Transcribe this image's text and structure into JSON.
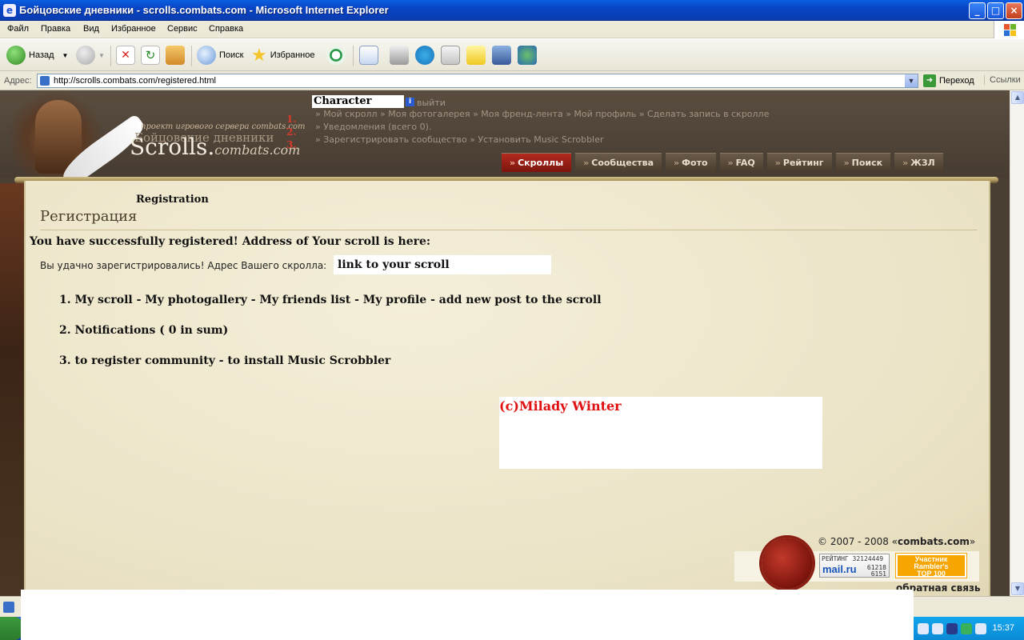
{
  "window": {
    "title": "Бойцовские дневники - scrolls.combats.com - Microsoft Internet Explorer",
    "min": "_",
    "max": "□",
    "close": "×"
  },
  "menu": [
    "Файл",
    "Правка",
    "Вид",
    "Избранное",
    "Сервис",
    "Справка"
  ],
  "toolbar": {
    "back": "Назад",
    "search": "Поиск",
    "favorites": "Избранное"
  },
  "address": {
    "label": "Адрес:",
    "url": "http://scrolls.combats.com/registered.html",
    "go": "Переход",
    "links": "Ссылки"
  },
  "site": {
    "logo_sub": "проект игрового сервера combats.com",
    "logo_ru": "Бойцовские дневники",
    "logo_main": "Scrolls.",
    "logo_domain": "combats.com",
    "nums": [
      "1.",
      "2.",
      "3."
    ],
    "character": "Character",
    "info_icon": "i",
    "logout": "выйти",
    "nav1": "» Мой скролл » Моя фотогалерея » Моя френд-лента » Мой профиль » Сделать запись в скролле",
    "nav2": "» Уведомления (всего 0).",
    "nav3": "» Зарегистрировать сообщество » Установить Music Scrobbler",
    "tabs": [
      "Скроллы",
      "Сообщества",
      "Фото",
      "FAQ",
      "Рейтинг",
      "Поиск",
      "ЖЗЛ"
    ],
    "tab_chevron": "»"
  },
  "page": {
    "reg_small": "Registration",
    "title": "Регистрация",
    "success": "You have successfully registered! Address of Your scroll is here:",
    "success_ru": "Вы удачно зарегистрировались! Адрес Вашего скролла:",
    "link": "link to your scroll",
    "item1": "1. My scroll - My photogallery - My friends list - My profile - add new post to the scroll",
    "item2": "2. Notifications ( 0 in sum)",
    "item3": "3. to register community - to install Music Scrobbler",
    "credit": "(c)Milady Winter"
  },
  "footer": {
    "copyright": "© 2007 - 2008 «",
    "copyright_site": "combats.com",
    "copyright_end": "»",
    "rating_label": "РЕЙТИНГ",
    "rating_num": "32124449",
    "mailru": "mail.ru",
    "n1": "61218",
    "n2": "6151",
    "rambler": [
      "Участник",
      "Rambler's",
      "TOP 100"
    ],
    "feedback": "обратная связь"
  },
  "tray": {
    "clock": "15:37"
  }
}
